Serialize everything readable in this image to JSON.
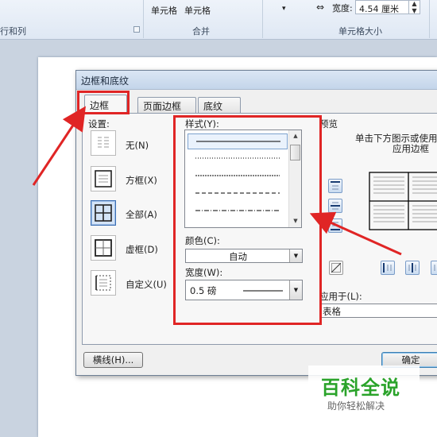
{
  "ribbon": {
    "group_rows_cols_label": "行和列",
    "cell_btn1": "单元格",
    "cell_btn2": "单元格",
    "merge_label": "合并",
    "width_label": "宽度:",
    "width_value": "4.54 厘米",
    "cell_size_label": "单元格大小"
  },
  "dialog": {
    "title": "边框和底纹",
    "tabs": [
      {
        "label": "边框(B)"
      },
      {
        "label": "页面边框(P)"
      },
      {
        "label": "底纹(S)"
      }
    ],
    "setting": {
      "label": "设置:",
      "items": [
        {
          "label": "无(N)"
        },
        {
          "label": "方框(X)"
        },
        {
          "label": "全部(A)"
        },
        {
          "label": "虚框(D)"
        },
        {
          "label": "自定义(U)"
        }
      ]
    },
    "style": {
      "label": "样式(Y):"
    },
    "color": {
      "label": "颜色(C):",
      "value": "自动"
    },
    "width": {
      "label": "宽度(W):",
      "value": "0.5 磅"
    },
    "preview": {
      "label": "预览",
      "hint_line1": "单击下方图示或使用",
      "hint_line2": "应用边框"
    },
    "apply_to": {
      "label": "应用于(L):",
      "value": "表格"
    },
    "horizontal_line_button": "横线(H)...",
    "ok_button": "确定"
  },
  "watermark": {
    "title": "百科全说",
    "subtitle": "助你轻松解决"
  },
  "colors": {
    "annotation_red": "#e02525",
    "watermark_green": "#2aa32a"
  }
}
